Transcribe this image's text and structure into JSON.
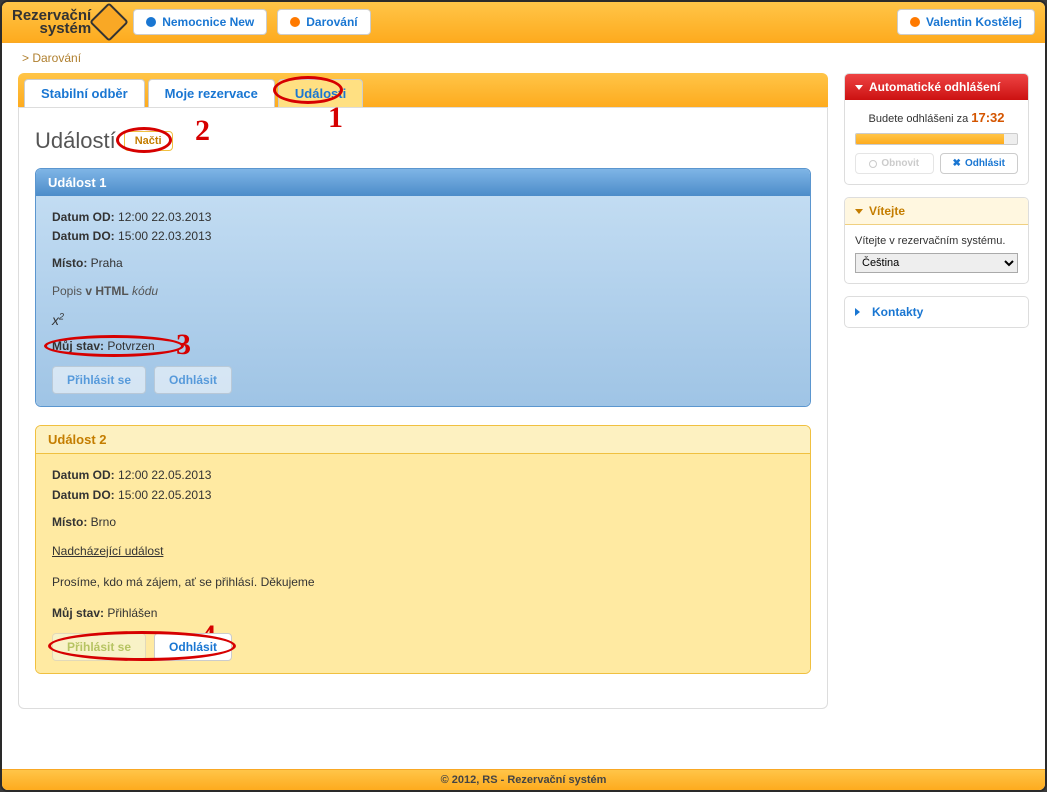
{
  "logo": {
    "line1": "Rezervační",
    "line2": "systém"
  },
  "header": {
    "btn1": "Nemocnice New",
    "btn2": "Darování",
    "user": "Valentin Kostělej"
  },
  "breadcrumb": "> Darování",
  "tabs": [
    {
      "label": "Stabilní odběr"
    },
    {
      "label": "Moje rezervace"
    },
    {
      "label": "Události",
      "active": true
    }
  ],
  "page_title": "Událostí",
  "load_btn": "Načti",
  "annotations": {
    "n1": "1",
    "n2": "2",
    "n3": "3",
    "n4": "4"
  },
  "event1": {
    "title": "Událost 1",
    "date_od_label": "Datum OD:",
    "date_od": "12:00 22.03.2013",
    "date_do_label": "Datum DO:",
    "date_do": "15:00 22.03.2013",
    "misto_label": "Místo:",
    "misto": "Praha",
    "popis_pre": "Popis ",
    "popis_b": "v HTML",
    "popis_it": " kódu",
    "sup": "x",
    "sup_exp": "2",
    "stav_label": "Můj stav:",
    "stav": "Potvrzen",
    "btn_in": "Přihlásit se",
    "btn_out": "Odhlásit"
  },
  "event2": {
    "title": "Událost 2",
    "date_od_label": "Datum OD:",
    "date_od": "12:00 22.05.2013",
    "date_do_label": "Datum DO:",
    "date_do": "15:00 22.05.2013",
    "misto_label": "Místo:",
    "misto": "Brno",
    "heading": "Nadcházející událost",
    "desc": "Prosíme, kdo má zájem, ať se přihlásí. Děkujeme",
    "stav_label": "Můj stav:",
    "stav": "Přihlášen",
    "btn_in": "Přihlásit se",
    "btn_out": "Odhlásit"
  },
  "sidebar": {
    "logout": {
      "title": "Automatické odhlášení",
      "msg_pre": "Budete odhlášeni za ",
      "time": "17:32",
      "btn_refresh": "Obnovit",
      "btn_logout": "Odhlásit",
      "progress_pct": 92
    },
    "welcome": {
      "title": "Vítejte",
      "msg": "Vítejte v rezervačním systému.",
      "lang": "Čeština"
    },
    "kontakty": "Kontakty"
  },
  "footer": "© 2012, RS - Rezervační systém"
}
